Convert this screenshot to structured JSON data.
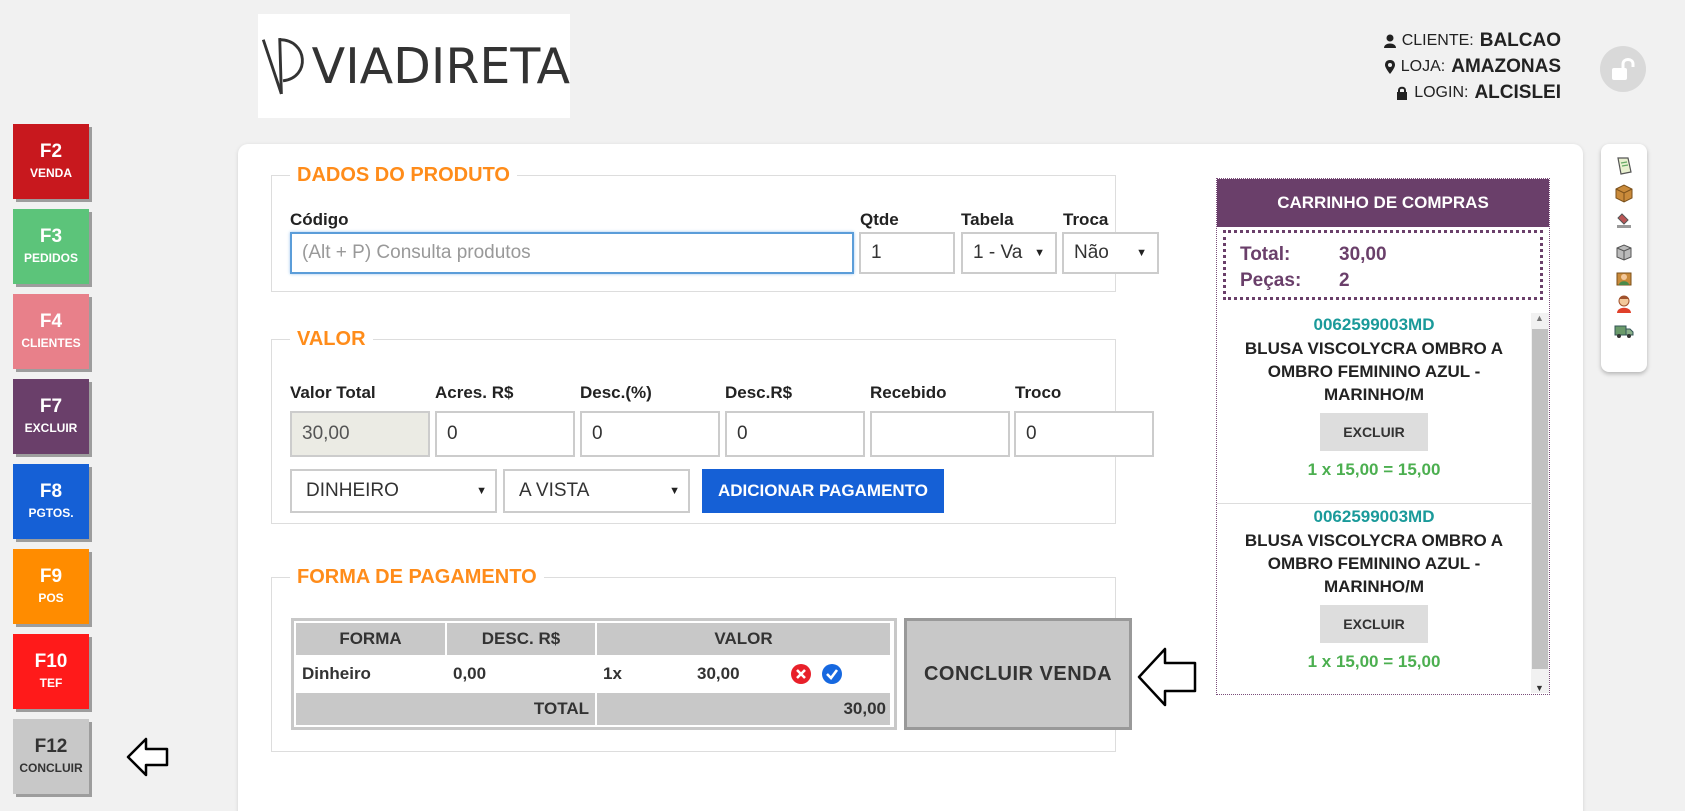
{
  "sidebar": {
    "keys": [
      {
        "key": "F2",
        "label": "VENDA",
        "color": "#c8181e"
      },
      {
        "key": "F3",
        "label": "PEDIDOS",
        "color": "#5cc47a"
      },
      {
        "key": "F4",
        "label": "CLIENTES",
        "color": "#e8808a"
      },
      {
        "key": "F7",
        "label": "EXCLUIR",
        "color": "#6a3f6a"
      },
      {
        "key": "F8",
        "label": "PGTOS.",
        "color": "#1560d6"
      },
      {
        "key": "F9",
        "label": "POS",
        "color": "#ff8c00"
      },
      {
        "key": "F10",
        "label": "TEF",
        "color": "#ff1a1a"
      },
      {
        "key": "F12",
        "label": "CONCLUIR",
        "color": "#c8c8c8"
      }
    ]
  },
  "logo": {
    "text": "VIADIRETA"
  },
  "user": {
    "cliente_label": "CLIENTE:",
    "cliente": "BALCAO",
    "loja_label": "LOJA:",
    "loja": "AMAZONAS",
    "login_label": "LOGIN:",
    "login": "ALCISLEI"
  },
  "produto": {
    "legend": "DADOS DO PRODUTO",
    "codigo_label": "Código",
    "codigo_placeholder": "(Alt + P) Consulta produtos",
    "qtde_label": "Qtde",
    "qtde": "1",
    "tabela_label": "Tabela",
    "tabela": "1 - Va",
    "troca_label": "Troca",
    "troca": "Não"
  },
  "valor": {
    "legend": "VALOR",
    "total_label": "Valor Total",
    "total": "30,00",
    "acres_label": "Acres. R$",
    "acres": "0",
    "desc_pct_label": "Desc.(%)",
    "desc_pct": "0",
    "desc_rs_label": "Desc.R$",
    "desc_rs": "0",
    "recebido_label": "Recebido",
    "recebido": "",
    "troco_label": "Troco",
    "troco": "0",
    "forma": "DINHEIRO",
    "condicao": "A VISTA",
    "add_button": "ADICIONAR PAGAMENTO"
  },
  "pagamento": {
    "legend": "FORMA DE PAGAMENTO",
    "headers": [
      "FORMA",
      "DESC. R$",
      "VALOR"
    ],
    "row": {
      "forma": "Dinheiro",
      "desc": "0,00",
      "parcelas": "1x",
      "valor": "30,00"
    },
    "total_label": "TOTAL",
    "total": "30,00",
    "concluir": "CONCLUIR VENDA"
  },
  "cart": {
    "title": "CARRINHO DE COMPRAS",
    "total_label": "Total:",
    "total": "30,00",
    "pecas_label": "Peças:",
    "pecas": "2",
    "items": [
      {
        "code": "0062599003MD",
        "name": "BLUSA VISCOLYCRA OMBRO A OMBRO FEMININO AZUL - MARINHO/M",
        "excluir": "EXCLUIR",
        "qty": "1 x 15,00 = 15,00"
      },
      {
        "code": "0062599003MD",
        "name": "BLUSA VISCOLYCRA OMBRO A OMBRO FEMININO AZUL - MARINHO/M",
        "excluir": "EXCLUIR",
        "qty": "1 x 15,00 = 15,00"
      }
    ]
  },
  "icons": {
    "toolbar": [
      "note-icon",
      "box-icon",
      "stamp-icon",
      "package-icon",
      "user-box-icon",
      "person-icon",
      "truck-icon"
    ]
  }
}
